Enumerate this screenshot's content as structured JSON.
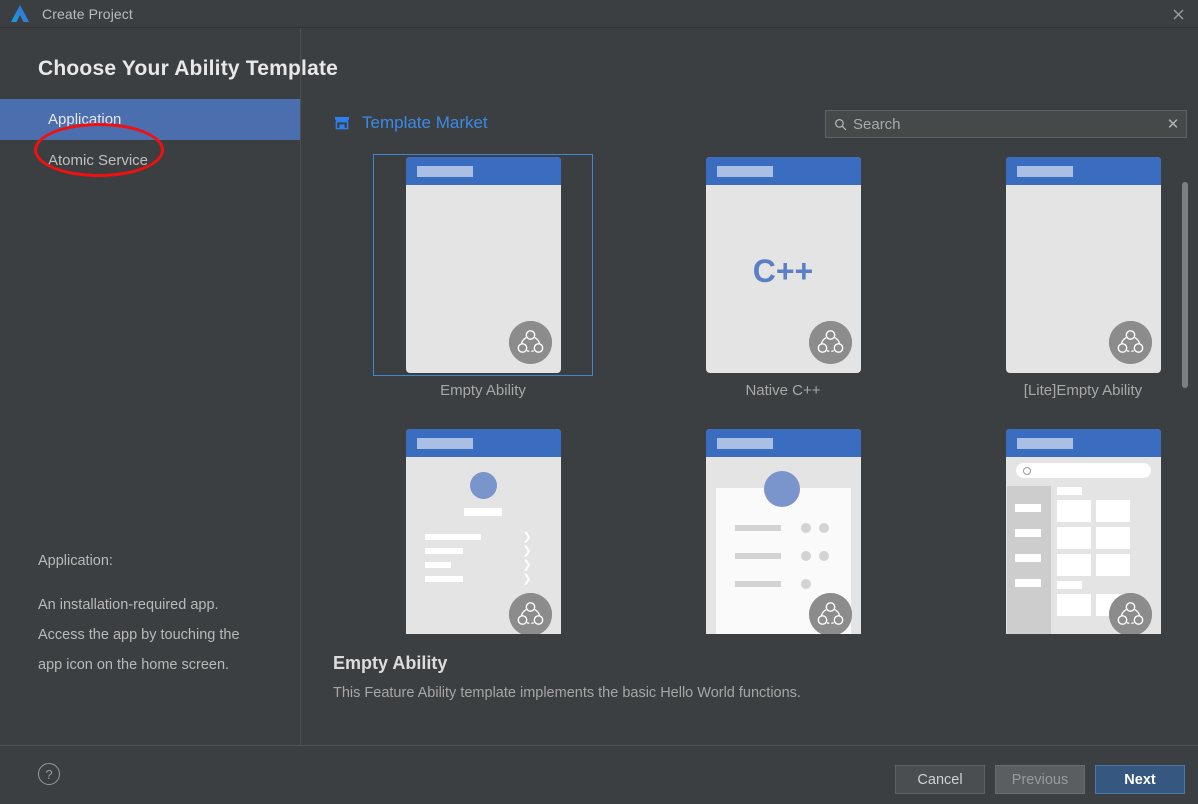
{
  "window": {
    "title": "Create Project",
    "logo_icon": "deveco-logo-icon",
    "close_icon": "close-icon"
  },
  "page": {
    "heading": "Choose Your Ability Template"
  },
  "categories": {
    "items": [
      {
        "label": "Application",
        "selected": true
      },
      {
        "label": "Atomic Service",
        "selected": false
      }
    ],
    "annotation": {
      "shape": "red-ellipse",
      "target": "Application",
      "color": "#f01010"
    }
  },
  "category_info": {
    "label": "Application:",
    "lines": [
      "An installation-required app.",
      "Access the app by touching the",
      "app icon on the home screen."
    ]
  },
  "market": {
    "icon": "store-icon",
    "label": "Template Market",
    "color": "#3b8ae8"
  },
  "search": {
    "icon": "search-icon",
    "placeholder": "Search",
    "value": "",
    "clear_icon": "close-icon",
    "clear_label": "✕"
  },
  "templates": [
    {
      "name": "Empty Ability",
      "art": "empty",
      "selected": true
    },
    {
      "name": "Native C++",
      "art": "cpp",
      "glyph": "C++",
      "selected": false
    },
    {
      "name": "[Lite]Empty Ability",
      "art": "empty",
      "selected": false
    },
    {
      "name": "",
      "art": "profile-list",
      "selected": false
    },
    {
      "name": "",
      "art": "profile-card",
      "selected": false
    },
    {
      "name": "",
      "art": "catalog",
      "selected": false
    }
  ],
  "selected_template": {
    "title": "Empty Ability",
    "description": "This Feature Ability template implements the basic Hello World functions."
  },
  "footer": {
    "help_icon": "help-icon",
    "help_label": "?",
    "cancel_label": "Cancel",
    "previous_label": "Previous",
    "next_label": "Next"
  }
}
